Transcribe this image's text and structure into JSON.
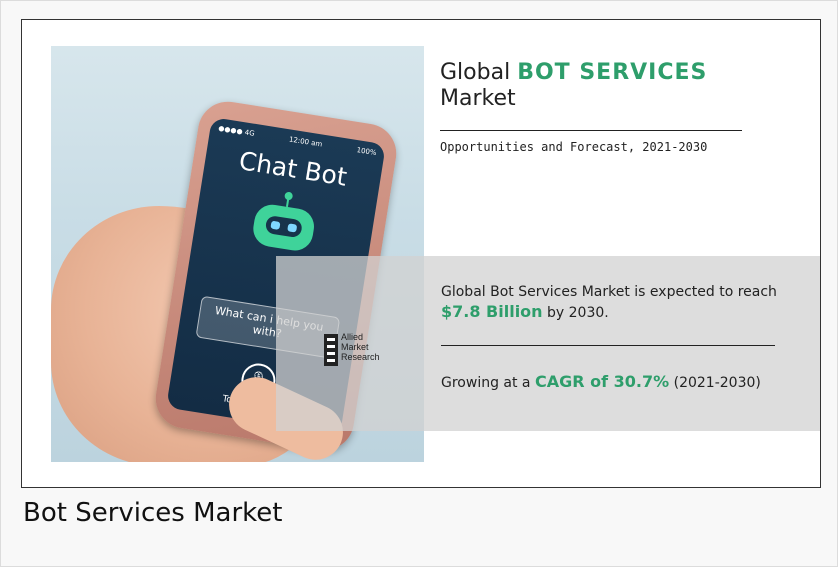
{
  "figure": {
    "title_prefix": "Global",
    "title_highlight": "BOT SERVICES",
    "title_suffix": "Market",
    "subtitle": "Opportunities and Forecast, 2021-2030",
    "stat1_prefix": "Global Bot Services Market is expected to reach",
    "stat1_value": "$7.8 Billion",
    "stat1_suffix": "by 2030.",
    "stat2_prefix": "Growing at a",
    "stat2_value": "CAGR of 30.7%",
    "stat2_suffix": "(2021-2030)",
    "logo_lines": [
      "Allied",
      "Market",
      "Research"
    ]
  },
  "phone": {
    "signal": "●●●● 4G",
    "time": "12:00 am",
    "battery": "100%",
    "app_title": "Chat Bot",
    "bubble_text": "What can i help you with?",
    "mic_label": "Touch to speak"
  },
  "caption": "Bot Services Market",
  "colors": {
    "accent": "#2e9e6b",
    "screen": "#1b3a55",
    "robot": "#3fd39a"
  },
  "icons": [
    "robot-icon",
    "microphone-icon",
    "logo-icon"
  ]
}
